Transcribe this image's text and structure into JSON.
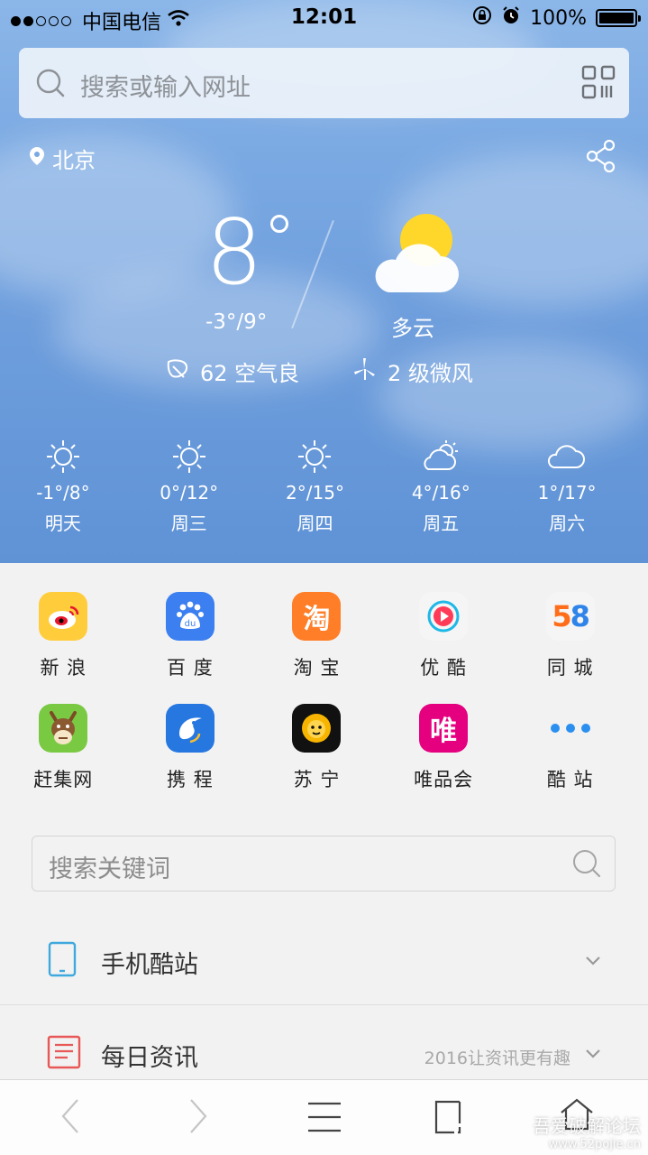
{
  "status": {
    "carrier": "中国电信",
    "time": "12:01",
    "battery": "100%"
  },
  "search": {
    "placeholder": "搜索或输入网址"
  },
  "weather": {
    "city": "北京",
    "temp": "8",
    "range": "-3°/9°",
    "condition": "多云",
    "aqi": "62 空气良",
    "wind": "2 级微风",
    "forecast": [
      {
        "range": "-1°/8°",
        "day": "明天",
        "icon": "sun-icon"
      },
      {
        "range": "0°/12°",
        "day": "周三",
        "icon": "sun-icon"
      },
      {
        "range": "2°/15°",
        "day": "周四",
        "icon": "sun-icon"
      },
      {
        "range": "4°/16°",
        "day": "周五",
        "icon": "partly-cloudy-icon"
      },
      {
        "range": "1°/17°",
        "day": "周六",
        "icon": "cloud-icon"
      }
    ]
  },
  "sites": [
    {
      "label": "新 浪",
      "icon": "sina-icon",
      "color": "#ffcd3c"
    },
    {
      "label": "百 度",
      "icon": "baidu-icon",
      "color": "#3b7ff0"
    },
    {
      "label": "淘 宝",
      "icon": "taobao-icon",
      "color": "#ff7e27"
    },
    {
      "label": "优 酷",
      "icon": "youku-icon",
      "color": "#1eb8e7"
    },
    {
      "label": "同 城",
      "icon": "58-icon",
      "color": "#ff6d1a"
    },
    {
      "label": "赶集网",
      "icon": "ganji-icon",
      "color": "#7ac943"
    },
    {
      "label": "携 程",
      "icon": "ctrip-icon",
      "color": "#2677e0"
    },
    {
      "label": "苏 宁",
      "icon": "suning-icon",
      "color": "#111111"
    },
    {
      "label": "唯品会",
      "icon": "vip-icon",
      "color": "#e4007f"
    },
    {
      "label": "酷 站",
      "icon": "more-dots-icon",
      "color": "#2b8ff0"
    }
  ],
  "site_logo_text": {
    "taobao": "淘",
    "baidu": "du",
    "vip": "唯",
    "fiftyeight_a": "5",
    "fiftyeight_b": "8"
  },
  "keyword_search": {
    "placeholder": "搜索关键词"
  },
  "sections": [
    {
      "title": "手机酷站",
      "subtitle": ""
    },
    {
      "title": "每日资讯",
      "subtitle": "2016让资讯更有趣"
    }
  ],
  "watermark": {
    "line1": "吾爱破解论坛",
    "line2": "www.52pojie.cn"
  }
}
